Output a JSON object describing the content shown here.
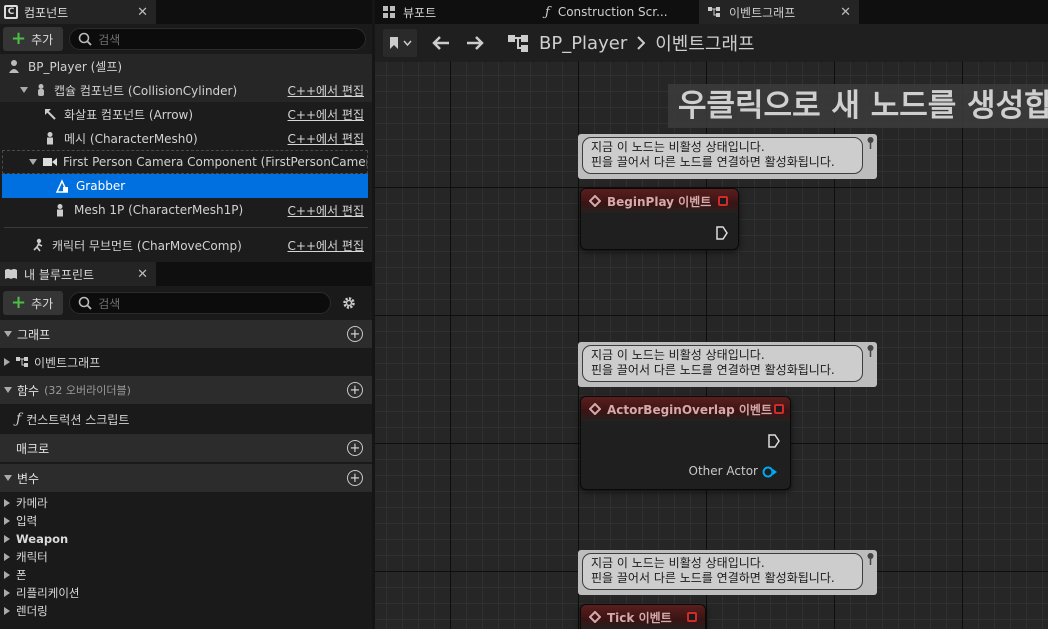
{
  "components_panel": {
    "tab_title": "컴포넌트",
    "add_label": "추가",
    "search_placeholder": "검색",
    "root": "BP_Player (셀프)",
    "edit_in_cpp": "C++에서 편집",
    "items": [
      {
        "label": "캡슐 컴포넌트 (CollisionCylinder)",
        "icon": "capsule-icon"
      },
      {
        "label": "화살표 컴포넌트 (Arrow)",
        "icon": "arrow-component-icon"
      },
      {
        "label": "메시 (CharacterMesh0)",
        "icon": "mesh-icon"
      },
      {
        "label": "First Person Camera Component (FirstPersonCamera",
        "icon": "camera-icon"
      },
      {
        "label": "Grabber",
        "icon": "grabber-icon",
        "selected": true
      },
      {
        "label": "Mesh 1P (CharacterMesh1P)",
        "icon": "mesh-icon"
      },
      {
        "label": "캐릭터 무브먼트 (CharMoveComp)",
        "icon": "movement-icon"
      }
    ]
  },
  "blueprint_panel": {
    "tab_title": "내 블루프린트",
    "add_label": "추가",
    "search_placeholder": "검색",
    "sections": {
      "graph": "그래프",
      "event_graph": "이벤트그래프",
      "functions": "함수",
      "functions_note": "(32 오버라이더블)",
      "construction_script": "컨스트럭션 스크립트",
      "macros": "매크로",
      "variables": "변수"
    },
    "variable_categories": [
      "카메라",
      "입력",
      "Weapon",
      "캐릭터",
      "폰",
      "리플리케이션",
      "렌더링"
    ]
  },
  "editor_tabs": [
    {
      "label": "뷰포트",
      "icon": "viewport-icon"
    },
    {
      "label": "Construction Scr...",
      "icon": "function-icon"
    },
    {
      "label": "이벤트그래프",
      "icon": "event-graph-icon",
      "active": true
    }
  ],
  "breadcrumb": {
    "blueprint": "BP_Player",
    "graph": "이벤트그래프"
  },
  "graph": {
    "hint": "우클릭으로 새 노드를 생성합",
    "comment_line1": "지금 이 노드는 비활성 상태입니다.",
    "comment_line2": "핀을 끌어서 다른 노드를 연결하면 활성화됩니다.",
    "nodes": [
      {
        "title": "BeginPlay 이벤트"
      },
      {
        "title": "ActorBeginOverlap 이벤트",
        "output_label": "Other Actor"
      },
      {
        "title": "Tick 이벤트"
      }
    ]
  },
  "colors": {
    "selection": "#0070e0",
    "node_header": "#5a1e1e",
    "event_pin": "#d12a2a",
    "object_pin": "#00a8f0",
    "add_plus": "#4bbf44"
  }
}
